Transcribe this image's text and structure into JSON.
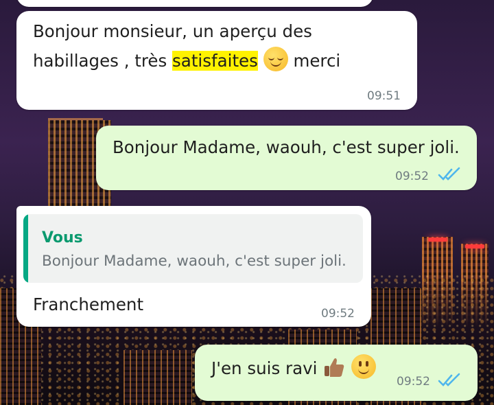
{
  "messages": [
    {
      "id": "m0",
      "direction": "incoming",
      "text_line1": "Bonjour monsieur, un aperçu des",
      "text_line2_pre": "habillages , très ",
      "highlight": "satisfaites",
      "emoji": "relieved-face-icon",
      "text_line2_post": " merci",
      "time": "09:51"
    },
    {
      "id": "m1",
      "direction": "outgoing",
      "text": "Bonjour Madame, waouh, c'est super joli.",
      "time": "09:52",
      "status": "read"
    },
    {
      "id": "m2",
      "direction": "incoming",
      "quote_author": "Vous",
      "quote_text": "Bonjour Madame, waouh, c'est super joli.",
      "text": "Franchement",
      "time": "09:52"
    },
    {
      "id": "m3",
      "direction": "outgoing",
      "text": "J'en suis ravi",
      "emojis": [
        "thumbs-up-icon",
        "smiling-face-icon"
      ],
      "time": "09:52",
      "status": "read"
    }
  ],
  "colors": {
    "incoming_bg": "#ffffff",
    "outgoing_bg": "#e3fbd4",
    "read_tick": "#4fb6ec",
    "quote_accent": "#06a884",
    "highlight": "#fff200"
  }
}
